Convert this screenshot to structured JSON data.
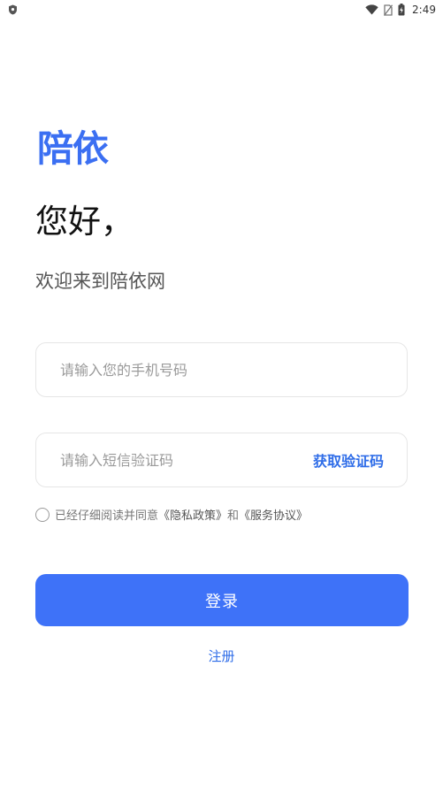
{
  "status_bar": {
    "time": "2:49",
    "icons": [
      "shield-icon",
      "wifi-icon",
      "no-sim-icon",
      "battery-charging-icon"
    ]
  },
  "app": {
    "logo_text": "陪依",
    "brand_color": "#3b6ff2"
  },
  "header": {
    "greeting": "您好，",
    "welcome": "欢迎来到陪依网"
  },
  "form": {
    "phone": {
      "value": "",
      "placeholder": "请输入您的手机号码"
    },
    "code": {
      "value": "",
      "placeholder": "请输入短信验证码",
      "get_code_label": "获取验证码"
    },
    "agreement": {
      "checked": false,
      "prefix": "已经仔细阅读并同意",
      "privacy_link": "《隐私政策》",
      "conjunction": "和",
      "service_link": "《服务协议》"
    },
    "login_label": "登录",
    "register_label": "注册"
  },
  "colors": {
    "primary_button": "#3e72f8",
    "link": "#2f6de8"
  }
}
